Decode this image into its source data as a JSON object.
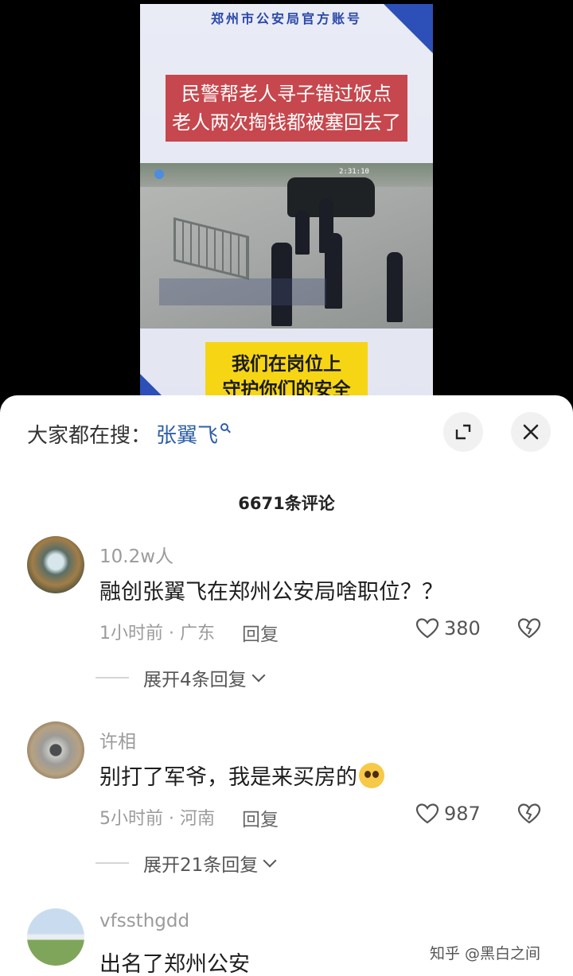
{
  "video": {
    "account_title": "郑州市公安局官方账号",
    "red_banner": [
      "民警帮老人寻子错过饭点",
      "老人两次掏钱都被塞回去了"
    ],
    "cctv_timestamp": "2:31:10",
    "yellow_banner": [
      "我们在岗位上",
      "守护你们的安全"
    ]
  },
  "sheet": {
    "search_prefix": "大家都在搜：",
    "search_term": "张翼飞",
    "comment_count": "6671条评论"
  },
  "comments": [
    {
      "author": "10.2w人",
      "text": "融创张翼飞在郑州公安局啥职位？？",
      "time_location": "1小时前 · 广东",
      "reply_label": "回复",
      "likes": "380",
      "expand_label": "展开4条回复"
    },
    {
      "author": "许相",
      "text": "别打了军爷，我是来买房的",
      "time_location": "5小时前 · 河南",
      "reply_label": "回复",
      "likes": "987",
      "expand_label": "展开21条回复"
    },
    {
      "author": "vfssthgdd",
      "text": "出名了郑州公安"
    }
  ],
  "watermark": "知乎 @黑白之间",
  "colors": {
    "link_blue": "#2e5fa8",
    "accent_blue": "#2c4fb8",
    "banner_red": "#c6474d",
    "banner_yellow": "#f6d614"
  }
}
